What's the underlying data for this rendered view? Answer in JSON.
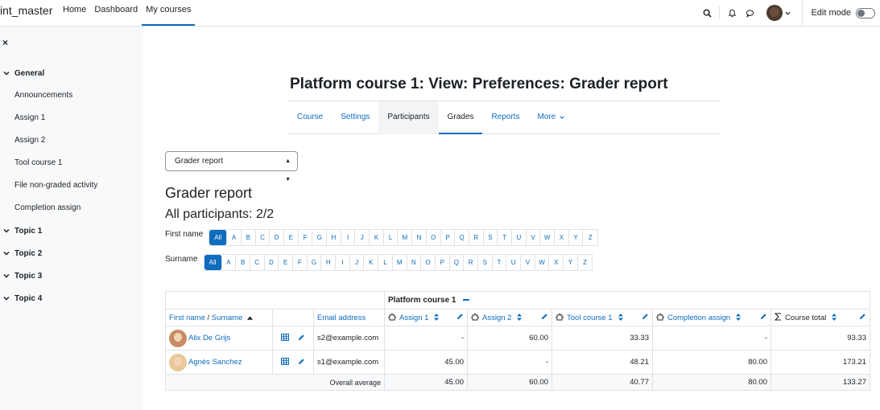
{
  "nav": {
    "site_name": "int_master",
    "links": [
      "Home",
      "Dashboard",
      "My courses"
    ],
    "edit_mode_label": "Edit mode"
  },
  "drawer": {
    "close_label": "×",
    "items": [
      {
        "type": "section",
        "label": "General"
      },
      {
        "type": "item",
        "label": "Announcements"
      },
      {
        "type": "item",
        "label": "Assign 1"
      },
      {
        "type": "item",
        "label": "Assign 2"
      },
      {
        "type": "item",
        "label": "Tool course 1"
      },
      {
        "type": "item",
        "label": "File non-graded activity"
      },
      {
        "type": "item",
        "label": "Completion assign"
      },
      {
        "type": "section",
        "label": "Topic 1"
      },
      {
        "type": "section",
        "label": "Topic 2"
      },
      {
        "type": "section",
        "label": "Topic 3"
      },
      {
        "type": "section",
        "label": "Topic 4"
      }
    ]
  },
  "page": {
    "title": "Platform course 1: View: Preferences: Grader report",
    "tabs": [
      "Course",
      "Settings",
      "Participants",
      "Grades",
      "Reports",
      "More"
    ],
    "report_select": "Grader report",
    "heading": "Grader report",
    "participants": "All participants: 2/2"
  },
  "filters": {
    "first_name_label": "First name",
    "surname_label": "Surname",
    "all_label": "All",
    "letters": [
      "A",
      "B",
      "C",
      "D",
      "E",
      "F",
      "G",
      "H",
      "I",
      "J",
      "K",
      "L",
      "M",
      "N",
      "O",
      "P",
      "Q",
      "R",
      "S",
      "T",
      "U",
      "V",
      "W",
      "X",
      "Y",
      "Z"
    ]
  },
  "table": {
    "category": "Platform course 1",
    "col_first": "First name",
    "col_sep": " / ",
    "col_surname": "Surname",
    "col_email": "Email address",
    "items": [
      {
        "name": "Assign 1"
      },
      {
        "name": "Assign 2"
      },
      {
        "name": "Tool course 1"
      },
      {
        "name": "Completion assign"
      },
      {
        "name": "Course total"
      }
    ],
    "rows": [
      {
        "name": "Alix De Grijs",
        "email": "s2@example.com",
        "grades": [
          "-",
          "60.00",
          "33.33",
          "-",
          "93.33"
        ]
      },
      {
        "name": "Agnès Sanchez",
        "email": "s1@example.com",
        "grades": [
          "45.00",
          "-",
          "48.21",
          "80.00",
          "173.21"
        ]
      }
    ],
    "overall_label": "Overall average",
    "overall": [
      "45.00",
      "60.00",
      "40.77",
      "80.00",
      "133.27"
    ]
  }
}
